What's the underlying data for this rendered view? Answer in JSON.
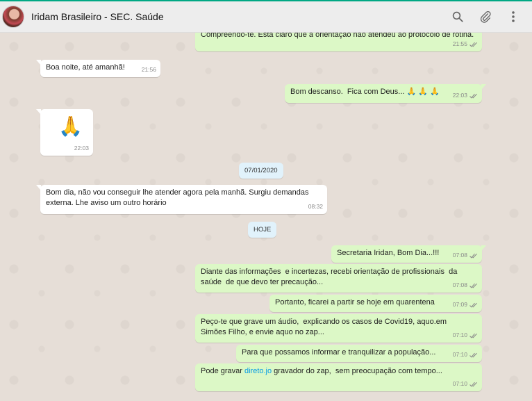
{
  "header": {
    "contact_name": "Iridam Brasileiro - SEC. Saúde",
    "icons": [
      "search-icon",
      "attach-icon",
      "menu-icon"
    ]
  },
  "messages": [
    {
      "dir": "out",
      "text": "Compreendo-te. Está claro que a orientação não atendeu ao protocolo de rotina.",
      "time": "21:55"
    },
    {
      "dir": "in",
      "text": "Boa noite, até amanhã!",
      "time": "21:56"
    },
    {
      "dir": "out",
      "text": "Bom descanso.  Fica com Deus...",
      "time": "22:03"
    },
    {
      "dir": "in",
      "emoji": "🙏",
      "time": "22:03"
    },
    {
      "dir": "in",
      "text": "Bom dia, não vou conseguir lhe atender agora pela manhã. Surgiu demandas externa. Lhe aviso um outro horário",
      "time": "08:32"
    },
    {
      "dir": "out",
      "text": "Secretaria Iridan, Bom Dia...!!!",
      "time": "07:08"
    },
    {
      "dir": "out",
      "text": "Diante das informações  e incertezas, recebi orientação de profissionais  da saúde  de que devo ter precaução...",
      "time": "07:08"
    },
    {
      "dir": "out",
      "text": "Portanto, ficarei a partir se hoje em quarentena",
      "time": "07:09"
    },
    {
      "dir": "out",
      "text": "Peço-te que grave um áudio,  explicando os casos de Covid19, aquo.em Simões Filho, e envie aquo no zap...",
      "time": "07:10"
    },
    {
      "dir": "out",
      "text": "Para que possamos informar e tranquilizar a população...",
      "time": "07:10"
    },
    {
      "dir": "out",
      "text_before": "Pode gravar ",
      "link": "direto.jo",
      "text_after": " gravador do zap,  sem preocupação com tempo...",
      "time": "07:10"
    }
  ],
  "date_chips": [
    "07/01/2020",
    "HOJE"
  ],
  "colors": {
    "outgoing": "#dcf8c6",
    "incoming": "#ffffff",
    "chip": "#e1f2fb",
    "accent": "#00a884",
    "link": "#039be5"
  }
}
